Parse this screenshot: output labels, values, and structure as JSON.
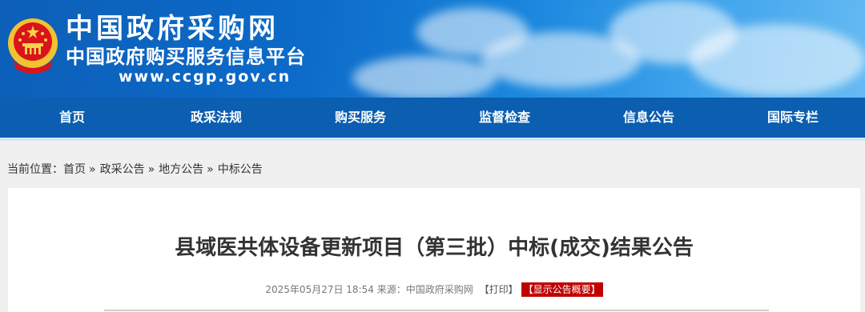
{
  "header": {
    "site_title": "中国政府采购网",
    "site_subtitle": "中国政府购买服务信息平台",
    "site_url": "www.ccgp.gov.cn",
    "emblem_icon": "national-emblem-icon"
  },
  "nav": {
    "items": [
      {
        "label": "首页"
      },
      {
        "label": "政采法规"
      },
      {
        "label": "购买服务"
      },
      {
        "label": "监督检查"
      },
      {
        "label": "信息公告"
      },
      {
        "label": "国际专栏"
      }
    ]
  },
  "breadcrumb": {
    "prefix": "当前位置：",
    "items": [
      "首页",
      "政采公告",
      "地方公告",
      "中标公告"
    ],
    "separator": "»"
  },
  "article": {
    "title": "县域医共体设备更新项目（第三批）中标(成交)结果公告",
    "date": "2025年05月27日 18:54",
    "source_label": "来源：",
    "source": "中国政府采购网",
    "print_label": "【打印】",
    "summary_label": "【显示公告概要】"
  },
  "colors": {
    "nav_bg": "#0b5eb0",
    "banner_blue": "#0d5fb8",
    "summary_badge": "#c00000"
  }
}
